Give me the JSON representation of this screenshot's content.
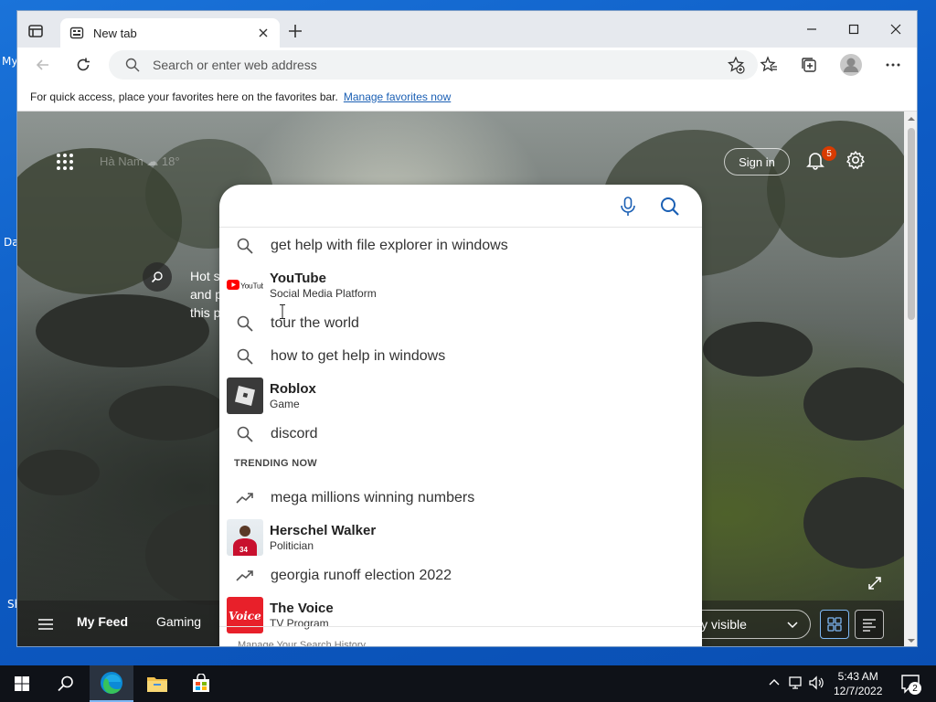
{
  "desktop": {
    "fragments": [
      "My",
      "Da",
      "Sh"
    ]
  },
  "browser": {
    "tab": {
      "title": "New tab",
      "icon": "new-tab-page-icon"
    },
    "address": {
      "placeholder": "Search or enter web address"
    },
    "favbar": {
      "message": "For quick access, place your favorites here on the favorites bar.",
      "link": "Manage favorites now"
    }
  },
  "ntp": {
    "weather": "Hà Nam ☁ 18°",
    "signin": "Sign in",
    "notifications_count": "5",
    "hot_searches": [
      "Hot s",
      "and p",
      "this p"
    ],
    "feed": {
      "tabs": [
        "My Feed",
        "Gaming"
      ],
      "visibility": "ly visible"
    }
  },
  "search": {
    "suggestions": [
      {
        "type": "query",
        "text": "get help with file explorer in windows",
        "icon": "search-icon"
      },
      {
        "type": "entity",
        "title": "YouTube",
        "subtitle": "Social Media Platform",
        "thumb": "youtube-logo"
      },
      {
        "type": "query",
        "text": "tour the world",
        "icon": "search-icon"
      },
      {
        "type": "query",
        "text": "how to get help in windows",
        "icon": "search-icon"
      },
      {
        "type": "entity",
        "title": "Roblox",
        "subtitle": "Game",
        "thumb": "roblox-logo"
      },
      {
        "type": "query",
        "text": "discord",
        "icon": "search-icon"
      }
    ],
    "trending_header": "TRENDING NOW",
    "trending": [
      {
        "type": "query",
        "text": "mega millions winning numbers",
        "icon": "trending-icon"
      },
      {
        "type": "entity",
        "title": "Herschel Walker",
        "subtitle": "Politician",
        "thumb": "herschel-photo"
      },
      {
        "type": "query",
        "text": "georgia runoff election 2022",
        "icon": "trending-icon"
      },
      {
        "type": "entity",
        "title": "The Voice",
        "subtitle": "TV Program",
        "thumb": "the-voice-logo"
      }
    ],
    "manage_history": "Manage Your Search History"
  },
  "taskbar": {
    "time": "5:43 AM",
    "date": "12/7/2022",
    "notification_count": "2"
  },
  "colors": {
    "accent": "#1a5fb4",
    "badge": "#d83b01",
    "youtube_red": "#ff0000",
    "voice_red": "#e8202a"
  }
}
